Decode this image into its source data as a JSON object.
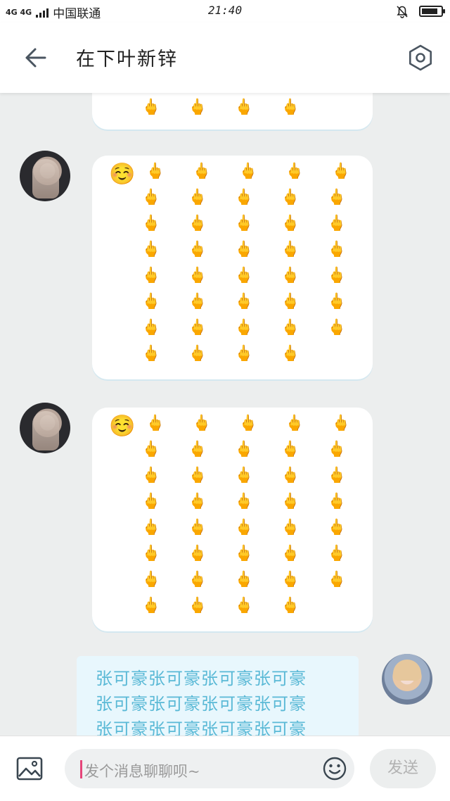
{
  "status_bar": {
    "network": "4G 4G",
    "carrier": "中国联通",
    "time": "21:40",
    "battery_level": 0.85
  },
  "header": {
    "title": "在下叶新锌",
    "back_icon": "arrow-left-icon",
    "settings_icon": "hexagon-settings-icon"
  },
  "messages": [
    {
      "sender": "other",
      "emoji_lead": "☺️",
      "glyph": "🖕"
    },
    {
      "sender": "other",
      "emoji_lead": "☺️",
      "glyph": "🖕"
    },
    {
      "sender": "me",
      "lines": [
        "张可豪张可豪张可豪张可豪",
        "张可豪张可豪张可豪张可豪",
        "张可豪张可豪张可豪张可豪"
      ]
    }
  ],
  "input_bar": {
    "placeholder": "发个消息聊聊呗~",
    "send_label": "发送",
    "image_icon": "image-icon",
    "emoji_icon": "smiley-icon"
  },
  "colors": {
    "accent_text": "#5ab9d6",
    "caret": "#e6457a",
    "bubble_sent": "#e8f7fd"
  }
}
